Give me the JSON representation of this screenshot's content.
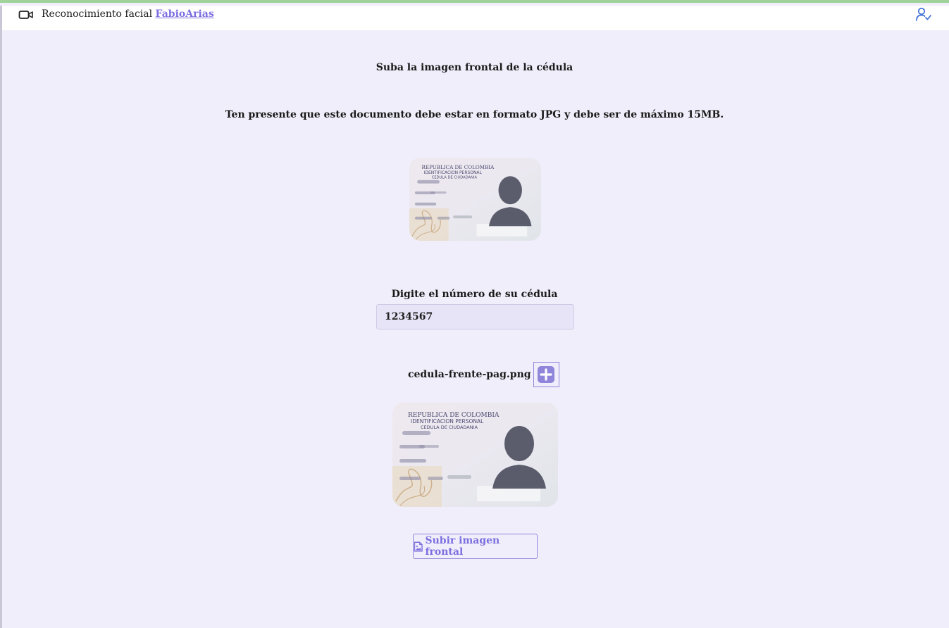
{
  "header": {
    "title": "Reconocimiento facial",
    "user_link": "FabioArias",
    "icons": [
      "video-camera-icon",
      "user-check-icon"
    ]
  },
  "instructions": {
    "title": "Suba la imagen frontal de la cédula",
    "note": "Ten presente que este documento debe estar en formato JPG y debe ser de máximo 15MB."
  },
  "id_card": {
    "line1": "REPUBLICA DE COLOMBIA",
    "line2": "IDENTIFICACION PERSONAL",
    "line3": "CEDULA DE CIUDADANIA"
  },
  "form": {
    "cedula_label": "Digite el número de su cédula",
    "cedula_value": "1234567",
    "file_name": "cedula-frente-pag.png",
    "upload_button": "Subir imagen frontal"
  },
  "colors": {
    "accent": "#7b6fe0",
    "background": "#f0eefa",
    "user_icon": "#3b6fd6"
  }
}
